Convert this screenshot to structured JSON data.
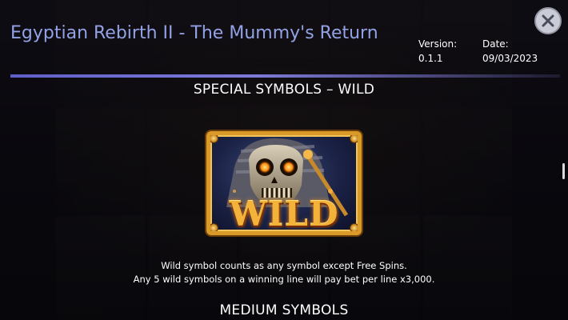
{
  "header": {
    "title": "Egyptian Rebirth II - The Mummy's Return",
    "version_label": "Version:",
    "version_value": "0.1.1",
    "date_label": "Date:",
    "date_value": "09/03/2023"
  },
  "close_button": {
    "icon": "close-icon"
  },
  "sections": {
    "wild": {
      "heading": "SPECIAL SYMBOLS – WILD",
      "symbol_text": "WILD",
      "description_line1": "Wild symbol counts as any symbol except Free Spins.",
      "description_line2": "Any 5 wild symbols on a winning line will pay bet per line x3,000."
    },
    "medium": {
      "heading": "MEDIUM SYMBOLS"
    }
  },
  "colors": {
    "title": "#93a2e6",
    "rule": "#7d7ad8",
    "frame_gold": "#d99a2a",
    "wild_text": "#f3b23a"
  }
}
